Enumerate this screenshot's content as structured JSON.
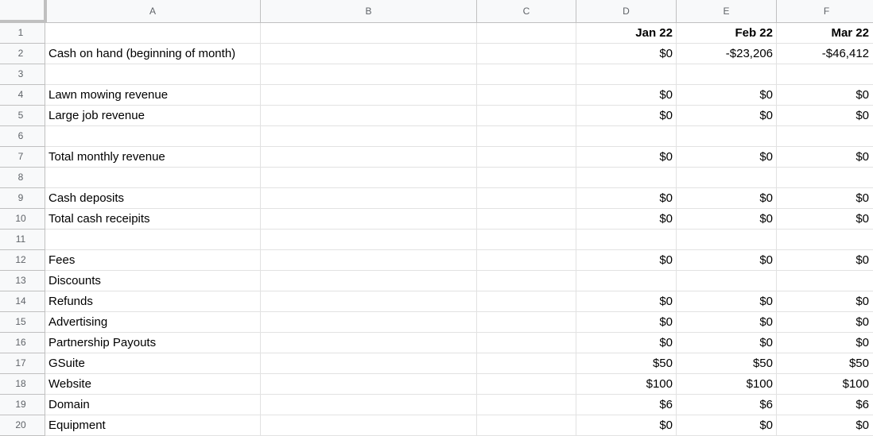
{
  "columns": [
    "A",
    "B",
    "C",
    "D",
    "E",
    "F"
  ],
  "rows": [
    {
      "n": "1",
      "label": "",
      "d": "Jan 22",
      "e": "Feb 22",
      "f": "Mar 22",
      "bold": true
    },
    {
      "n": "2",
      "label": "Cash on hand (beginning of month)",
      "d": "$0",
      "e": "-$23,206",
      "f": "-$46,412"
    },
    {
      "n": "3",
      "label": "",
      "d": "",
      "e": "",
      "f": ""
    },
    {
      "n": "4",
      "label": "Lawn mowing revenue",
      "d": "$0",
      "e": "$0",
      "f": "$0"
    },
    {
      "n": "5",
      "label": "Large job revenue",
      "d": "$0",
      "e": "$0",
      "f": "$0"
    },
    {
      "n": "6",
      "label": "",
      "d": "",
      "e": "",
      "f": ""
    },
    {
      "n": "7",
      "label": "Total monthly revenue",
      "d": "$0",
      "e": "$0",
      "f": "$0"
    },
    {
      "n": "8",
      "label": "",
      "d": "",
      "e": "",
      "f": ""
    },
    {
      "n": "9",
      "label": "Cash deposits",
      "d": "$0",
      "e": "$0",
      "f": "$0"
    },
    {
      "n": "10",
      "label": "Total cash receipits",
      "d": "$0",
      "e": "$0",
      "f": "$0"
    },
    {
      "n": "11",
      "label": "",
      "d": "",
      "e": "",
      "f": ""
    },
    {
      "n": "12",
      "label": "Fees",
      "d": "$0",
      "e": "$0",
      "f": "$0"
    },
    {
      "n": "13",
      "label": "Discounts",
      "d": "",
      "e": "",
      "f": ""
    },
    {
      "n": "14",
      "label": "Refunds",
      "d": "$0",
      "e": "$0",
      "f": "$0"
    },
    {
      "n": "15",
      "label": "Advertising",
      "d": "$0",
      "e": "$0",
      "f": "$0"
    },
    {
      "n": "16",
      "label": "Partnership Payouts",
      "d": "$0",
      "e": "$0",
      "f": "$0"
    },
    {
      "n": "17",
      "label": "GSuite",
      "d": "$50",
      "e": "$50",
      "f": "$50"
    },
    {
      "n": "18",
      "label": "Website",
      "d": "$100",
      "e": "$100",
      "f": "$100"
    },
    {
      "n": "19",
      "label": "Domain",
      "d": "$6",
      "e": "$6",
      "f": "$6"
    },
    {
      "n": "20",
      "label": "Equipment",
      "d": "$0",
      "e": "$0",
      "f": "$0"
    }
  ]
}
